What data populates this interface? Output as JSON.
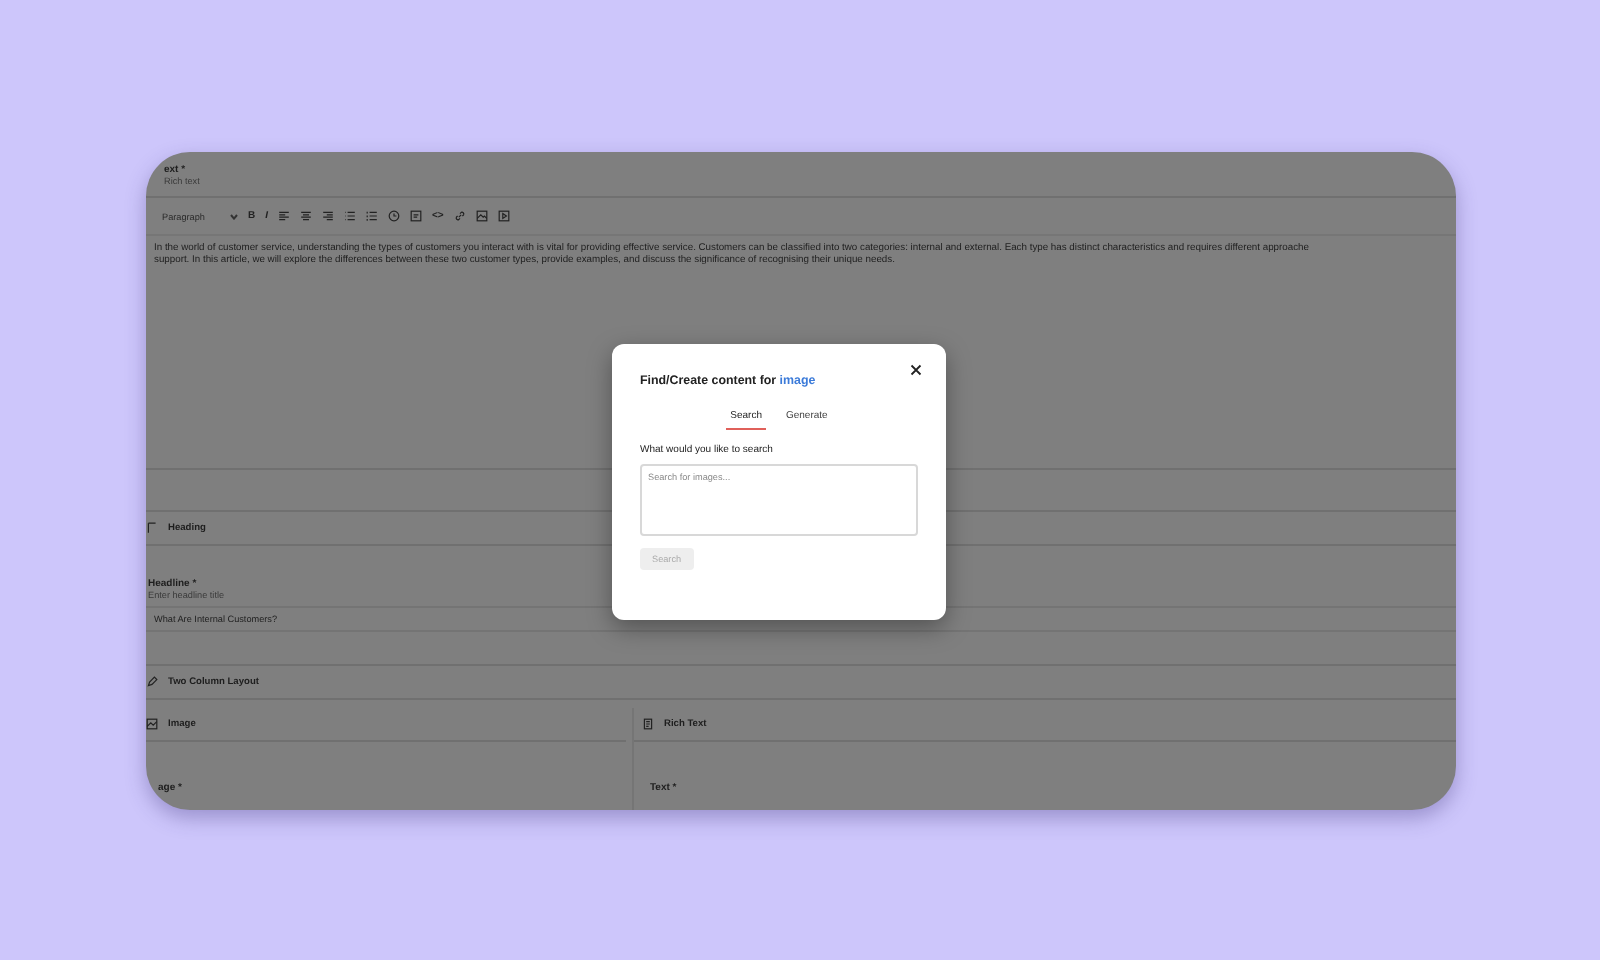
{
  "editor": {
    "field_label": "ext *",
    "hint": "Rich text",
    "format": "Paragraph",
    "toolbar": [
      {
        "kind": "text",
        "label": "B"
      },
      {
        "kind": "text",
        "label": "I"
      },
      {
        "kind": "align-left"
      },
      {
        "kind": "align-center"
      },
      {
        "kind": "align-right"
      },
      {
        "kind": "bullets"
      },
      {
        "kind": "numbers"
      },
      {
        "kind": "clock"
      },
      {
        "kind": "quote"
      },
      {
        "kind": "text",
        "label": "<>"
      },
      {
        "kind": "link"
      },
      {
        "kind": "image"
      },
      {
        "kind": "embed"
      }
    ],
    "body": [
      "In the world of customer service, understanding the types of customers you interact with is vital for providing effective service. Customers can be classified into two categories: internal and external. Each type has distinct characteristics and requires different approache",
      "support. In this article, we will explore the differences between these two customer types, provide examples, and discuss the significance of recognising their unique needs."
    ]
  },
  "heading_section": {
    "title": "Heading",
    "label": "Headline *",
    "hint": "Enter headline title",
    "value": "What Are Internal Customers?"
  },
  "layout_section": {
    "title": "Two Column Layout"
  },
  "columns": [
    {
      "title": "Image",
      "field_label": "age *"
    },
    {
      "title": "Rich Text",
      "field_label": "Text *"
    }
  ],
  "modal": {
    "title": "Find/Create content for ",
    "title_link": "image",
    "tabs": [
      {
        "label": "Search",
        "selected": true
      },
      {
        "label": "Generate",
        "selected": false
      }
    ],
    "prompt": "What would you like to search",
    "placeholder": "Search for images...",
    "button": {
      "label": "Search",
      "disabled": true
    }
  }
}
